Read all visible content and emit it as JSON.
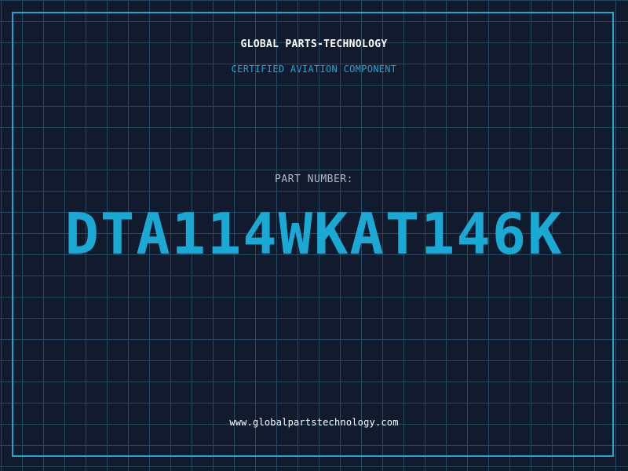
{
  "header": {
    "company": "GLOBAL PARTS-TECHNOLOGY",
    "subtitle": "CERTIFIED AVIATION COMPONENT"
  },
  "part": {
    "label": "PART NUMBER:",
    "number": "DTA114WKAT146K"
  },
  "footer": {
    "website": "www.globalpartstechnology.com"
  },
  "colors": {
    "background": "#121a2e",
    "grid": "#1f4a60",
    "accent": "#1aa8d4",
    "frame": "#23a3cf"
  }
}
